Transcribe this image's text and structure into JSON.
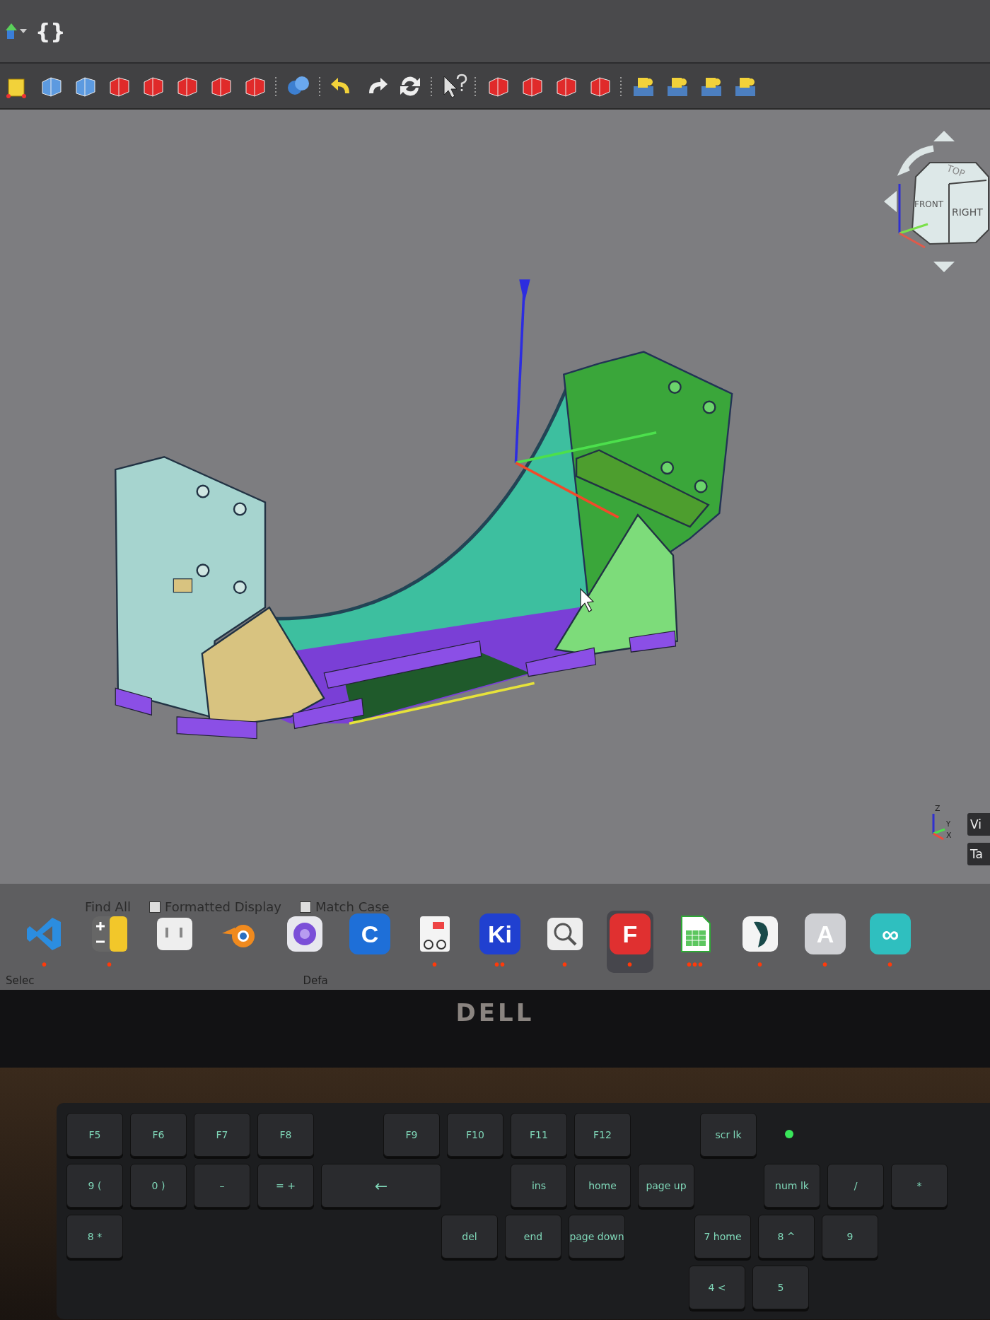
{
  "menu_row": {
    "text": "{}"
  },
  "nav_cube": {
    "faces": [
      "TOP",
      "FRONT",
      "RIGHT"
    ]
  },
  "axis_indicator": {
    "labels": [
      "Z",
      "Y",
      "X"
    ]
  },
  "side_tabs": [
    "Vi",
    "Ta"
  ],
  "find_bar": {
    "items": [
      {
        "kind": "button",
        "label": "Find All"
      },
      {
        "kind": "checkbox",
        "label": "Formatted Display",
        "checked": false
      },
      {
        "kind": "checkbox",
        "label": "Match Case",
        "checked": false
      }
    ],
    "lower": [
      "Selec",
      "Defa"
    ]
  },
  "dock": [
    {
      "kind": "vscode",
      "indicator": "•",
      "selected": false
    },
    {
      "kind": "calculator",
      "indicator": "•",
      "selected": false
    },
    {
      "kind": "panel",
      "selected": false
    },
    {
      "kind": "blender",
      "selected": false
    },
    {
      "kind": "camera",
      "selected": false
    },
    {
      "kind": "letter",
      "label": "C",
      "selected": false
    },
    {
      "kind": "reader",
      "indicator": "•",
      "selected": false
    },
    {
      "kind": "letter",
      "label": "Ki",
      "indicator": "••",
      "selected": false
    },
    {
      "kind": "search",
      "indicator": "•",
      "selected": false
    },
    {
      "kind": "letter",
      "label": "F",
      "indicator": "•",
      "selected": true
    },
    {
      "kind": "spreadsheet",
      "indicator": "•••",
      "selected": false
    },
    {
      "kind": "pen",
      "indicator": "•",
      "selected": false
    },
    {
      "kind": "letter",
      "label": "A",
      "indicator": "•",
      "selected": false
    },
    {
      "kind": "letter",
      "label": "∞",
      "indicator": "•",
      "selected": false
    }
  ],
  "monitor": {
    "brand": "DELL"
  },
  "keyboard": {
    "rows": [
      {
        "keys": [
          {
            "kind": "key",
            "label": "F5"
          },
          {
            "kind": "key",
            "label": "F6"
          },
          {
            "kind": "key",
            "label": "F7"
          },
          {
            "kind": "key",
            "label": "F8"
          },
          {
            "kind": "gap"
          },
          {
            "kind": "key",
            "label": "F9"
          },
          {
            "kind": "key",
            "label": "F10"
          },
          {
            "kind": "key",
            "label": "F11"
          },
          {
            "kind": "key",
            "label": "F12"
          },
          {
            "kind": "gap"
          },
          {
            "kind": "key",
            "label": "scr lk"
          },
          {
            "kind": "led"
          }
        ]
      },
      {
        "keys": [
          {
            "kind": "key",
            "label": "9 ("
          },
          {
            "kind": "key",
            "label": "0 )"
          },
          {
            "kind": "key",
            "label": "–"
          },
          {
            "kind": "key",
            "label": "= +"
          },
          {
            "kind": "wide",
            "label": "←"
          },
          {
            "kind": "gap"
          },
          {
            "kind": "key",
            "label": "ins"
          },
          {
            "kind": "key",
            "label": "home"
          },
          {
            "kind": "key",
            "label": "page up"
          },
          {
            "kind": "gap"
          },
          {
            "kind": "key",
            "label": "num lk"
          },
          {
            "kind": "key",
            "label": "/"
          },
          {
            "kind": "key",
            "label": "*"
          }
        ]
      },
      {
        "keys": [
          {
            "kind": "key",
            "label": "8 *"
          },
          {
            "kind": "gap"
          },
          {
            "kind": "gap"
          },
          {
            "kind": "gap"
          },
          {
            "kind": "gap"
          },
          {
            "kind": "gap"
          },
          {
            "kind": "key",
            "label": "del"
          },
          {
            "kind": "key",
            "label": "end"
          },
          {
            "kind": "key",
            "label": "page down"
          },
          {
            "kind": "gap"
          },
          {
            "kind": "key",
            "label": "7 home"
          },
          {
            "kind": "key",
            "label": "8 ^"
          },
          {
            "kind": "key",
            "label": "9"
          }
        ]
      },
      {
        "keys": [
          {
            "kind": "gap"
          },
          {
            "kind": "gap"
          },
          {
            "kind": "gap"
          },
          {
            "kind": "gap"
          },
          {
            "kind": "gap"
          },
          {
            "kind": "gap"
          },
          {
            "kind": "gap"
          },
          {
            "kind": "gap"
          },
          {
            "kind": "gap"
          },
          {
            "kind": "gap"
          },
          {
            "kind": "key",
            "label": "4 <"
          },
          {
            "kind": "key",
            "label": "5"
          }
        ]
      }
    ]
  }
}
